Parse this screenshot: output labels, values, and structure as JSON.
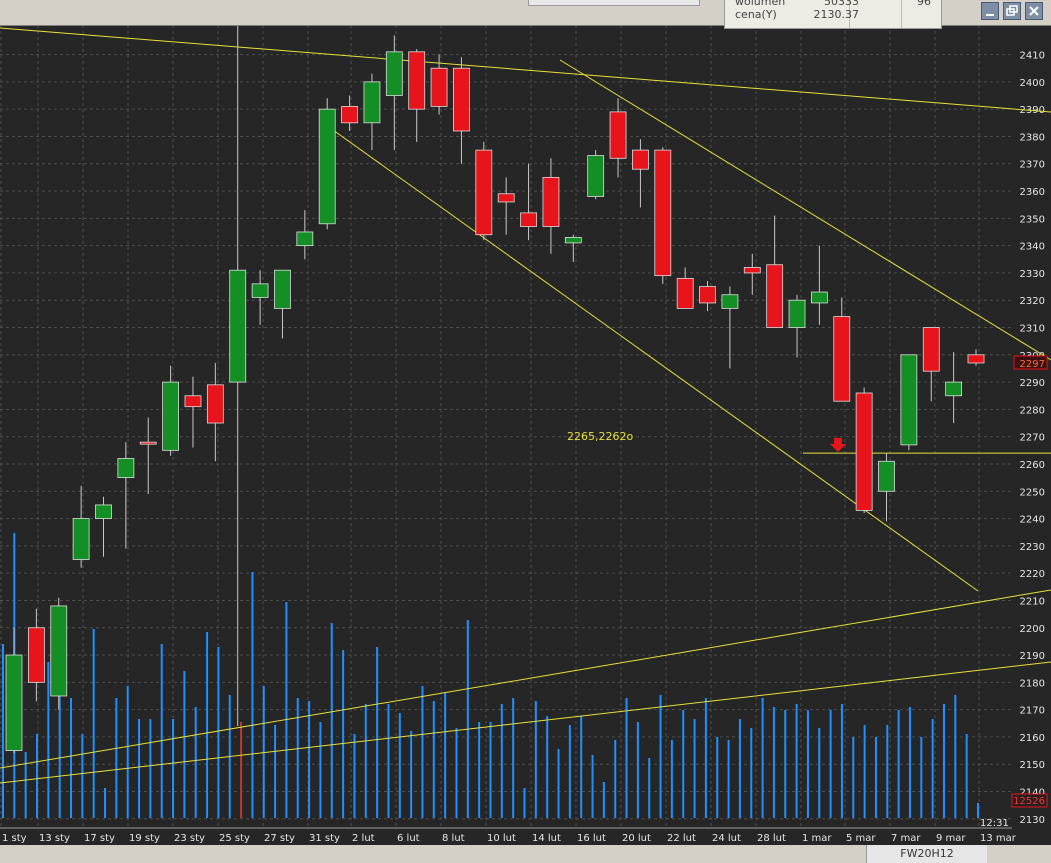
{
  "window": {
    "info_box": {
      "rows": [
        {
          "label": "wolumen",
          "value": "50333",
          "extra": "96"
        },
        {
          "label": "cena(Y)",
          "value": "2130.37",
          "extra": ""
        }
      ]
    },
    "buttons": [
      "minimize",
      "restore",
      "close"
    ],
    "bottom_tab": "FW20H12"
  },
  "chart_data": {
    "type": "candlestick",
    "x_tick_labels": [
      "1 sty",
      "13 sty",
      "17 sty",
      "19 sty",
      "23 sty",
      "25 sty",
      "27 sty",
      "31 sty",
      "2 lut",
      "6 lut",
      "8 lut",
      "10 lut",
      "14 lut",
      "16 lut",
      "20 lut",
      "22 lut",
      "24 lut",
      "28 lut",
      "1 mar",
      "5 mar",
      "7 mar",
      "9 mar",
      "13 mar"
    ],
    "y_ticks": [
      2130,
      2140,
      2150,
      2160,
      2170,
      2180,
      2190,
      2200,
      2210,
      2220,
      2230,
      2240,
      2250,
      2260,
      2270,
      2280,
      2290,
      2300,
      2310,
      2320,
      2330,
      2340,
      2350,
      2360,
      2370,
      2380,
      2390,
      2400,
      2410
    ],
    "ylim": [
      2127,
      2419
    ],
    "grid": true,
    "candles": [
      {
        "o": 2155,
        "h": 2200,
        "l": 2154,
        "c": 2190
      },
      {
        "o": 2200,
        "h": 2207,
        "l": 2173,
        "c": 2180
      },
      {
        "o": 2175,
        "h": 2211,
        "l": 2170,
        "c": 2208
      },
      {
        "o": 2225,
        "h": 2252,
        "l": 2222,
        "c": 2240
      },
      {
        "o": 2240,
        "h": 2248,
        "l": 2226,
        "c": 2245
      },
      {
        "o": 2255,
        "h": 2268,
        "l": 2229,
        "c": 2262
      },
      {
        "o": 2268,
        "h": 2277,
        "l": 2249,
        "c": 2268
      },
      {
        "o": 2265,
        "h": 2296,
        "l": 2263,
        "c": 2290
      },
      {
        "o": 2285,
        "h": 2292,
        "l": 2266,
        "c": 2281
      },
      {
        "o": 2289,
        "h": 2297,
        "l": 2261,
        "c": 2275
      },
      {
        "o": 2290,
        "h": 2421,
        "l": 2164,
        "c": 2331
      },
      {
        "o": 2321,
        "h": 2331,
        "l": 2311,
        "c": 2326
      },
      {
        "o": 2317,
        "h": 2331,
        "l": 2306,
        "c": 2331
      },
      {
        "o": 2340,
        "h": 2353,
        "l": 2335,
        "c": 2345
      },
      {
        "o": 2348,
        "h": 2394,
        "l": 2346,
        "c": 2390
      },
      {
        "o": 2391,
        "h": 2395,
        "l": 2382,
        "c": 2385
      },
      {
        "o": 2385,
        "h": 2403,
        "l": 2375,
        "c": 2400
      },
      {
        "o": 2395,
        "h": 2417,
        "l": 2375,
        "c": 2411
      },
      {
        "o": 2411,
        "h": 2412,
        "l": 2378,
        "c": 2390
      },
      {
        "o": 2405,
        "h": 2410,
        "l": 2388,
        "c": 2391
      },
      {
        "o": 2405,
        "h": 2409,
        "l": 2370,
        "c": 2382
      },
      {
        "o": 2375,
        "h": 2378,
        "l": 2342,
        "c": 2344
      },
      {
        "o": 2359,
        "h": 2365,
        "l": 2344,
        "c": 2356
      },
      {
        "o": 2352,
        "h": 2370,
        "l": 2342,
        "c": 2347
      },
      {
        "o": 2365,
        "h": 2372,
        "l": 2337,
        "c": 2347
      },
      {
        "o": 2341,
        "h": 2344,
        "l": 2334,
        "c": 2343
      },
      {
        "o": 2358,
        "h": 2375,
        "l": 2357,
        "c": 2373
      },
      {
        "o": 2389,
        "h": 2394,
        "l": 2365,
        "c": 2372
      },
      {
        "o": 2375,
        "h": 2379,
        "l": 2354,
        "c": 2368
      },
      {
        "o": 2375,
        "h": 2376,
        "l": 2326,
        "c": 2329
      },
      {
        "o": 2328,
        "h": 2332,
        "l": 2319,
        "c": 2317
      },
      {
        "o": 2325,
        "h": 2327,
        "l": 2316,
        "c": 2319
      },
      {
        "o": 2317,
        "h": 2325,
        "l": 2295,
        "c": 2322
      },
      {
        "o": 2332,
        "h": 2337,
        "l": 2322,
        "c": 2330
      },
      {
        "o": 2333,
        "h": 2351,
        "l": 2310,
        "c": 2310
      },
      {
        "o": 2310,
        "h": 2322,
        "l": 2299,
        "c": 2320
      },
      {
        "o": 2319,
        "h": 2340,
        "l": 2311,
        "c": 2323
      },
      {
        "o": 2314,
        "h": 2321,
        "l": 2283,
        "c": 2283
      },
      {
        "o": 2286,
        "h": 2288,
        "l": 2242,
        "c": 2243
      },
      {
        "o": 2250,
        "h": 2264,
        "l": 2239,
        "c": 2261
      },
      {
        "o": 2267,
        "h": 2300,
        "l": 2265,
        "c": 2300
      },
      {
        "o": 2310,
        "h": 2310,
        "l": 2283,
        "c": 2294
      },
      {
        "o": 2285,
        "h": 2301,
        "l": 2275,
        "c": 2290
      },
      {
        "o": 2300,
        "h": 2302,
        "l": 2296,
        "c": 2297
      }
    ],
    "volumes_rel": [
      0.58,
      0.95,
      0.22,
      0.28,
      0.52,
      0.58,
      0.4,
      0.28,
      0.63,
      0.1,
      0.4,
      0.44,
      0.33,
      0.33,
      0.58,
      0.33,
      0.49,
      0.37,
      0.62,
      0.57,
      0.41,
      0.32,
      0.82,
      0.44,
      0.31,
      0.72,
      0.4,
      0.39,
      0.32,
      0.65,
      0.56,
      0.28,
      0.38,
      0.57,
      0.38,
      0.35,
      0.29,
      0.44,
      0.39,
      0.42,
      0.3,
      0.66,
      0.32,
      0.32,
      0.38,
      0.4,
      0.1,
      0.39,
      0.34,
      0.23,
      0.31,
      0.34,
      0.21,
      0.12,
      0.26,
      0.4,
      0.32,
      0.2,
      0.41,
      0.26,
      0.36,
      0.33,
      0.4,
      0.27,
      0.26,
      0.33,
      0.3,
      0.4,
      0.37,
      0.36,
      0.38,
      0.36,
      0.3,
      0.36,
      0.38,
      0.27,
      0.31,
      0.27,
      0.31,
      0.36,
      0.37,
      0.27,
      0.33,
      0.38,
      0.41,
      0.28,
      0.05
    ],
    "volume_value_label": "12526",
    "price_label": "2297",
    "annotation": "2265,2262o",
    "time_label": "12:31",
    "horizontal_level": 2264
  }
}
